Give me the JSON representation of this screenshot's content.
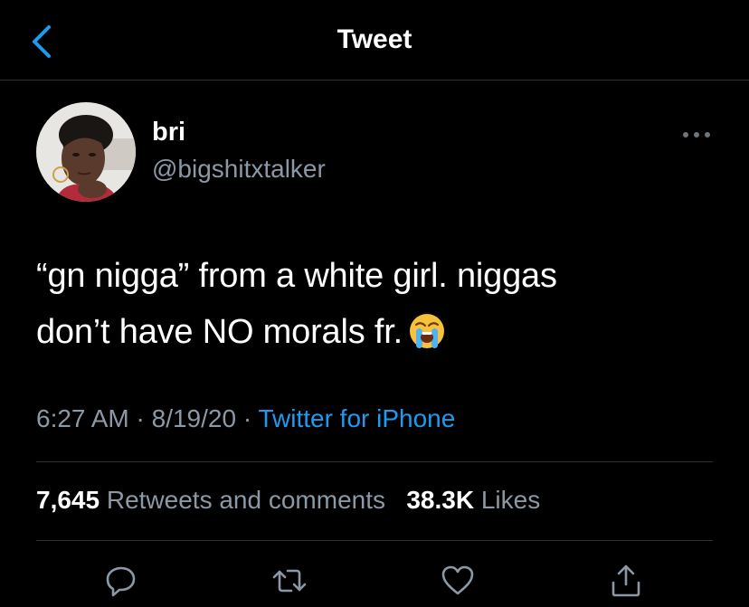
{
  "header": {
    "title": "Tweet"
  },
  "author": {
    "display_name": "bri",
    "handle": "@bigshitxtalker"
  },
  "tweet": {
    "line1": "“gn nigga” from a white girl. niggas",
    "line2": "don’t have NO morals fr.",
    "emoji": "loudly-crying-face"
  },
  "meta": {
    "time": "6:27 AM",
    "separator": " · ",
    "date": "8/19/20",
    "source": "Twitter for iPhone"
  },
  "stats": {
    "retweets_count": "7,645",
    "retweets_label": "Retweets and comments",
    "likes_count": "38.3K",
    "likes_label": "Likes"
  },
  "actions": [
    "reply-icon",
    "retweet-icon",
    "like-icon",
    "share-icon"
  ],
  "colors": {
    "background": "#000000",
    "accent": "#1d9bf0",
    "secondary_text": "#8b98a5",
    "divider": "#2f3336"
  }
}
